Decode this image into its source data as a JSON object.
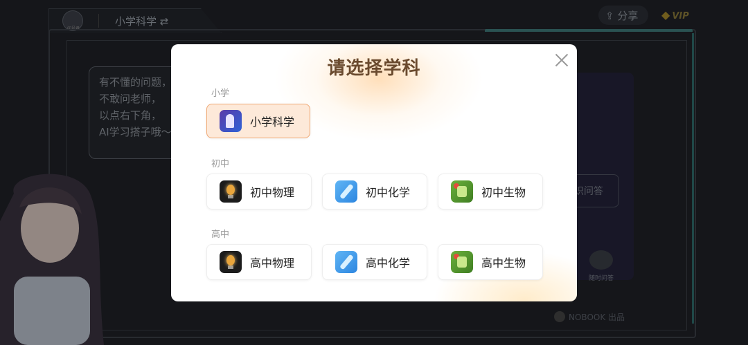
{
  "header": {
    "current_subject": "小学科学 ⇄",
    "share_label": "⇪ 分享",
    "vip_label": "VIP",
    "logo_caption": "问号君"
  },
  "speech_bubble": {
    "lines": [
      "有不懂的问题，",
      "不敢问老师，",
      "以点右下角，",
      "AI学习搭子哦～"
    ]
  },
  "right_panel": {
    "qa_button": "识问答",
    "bot_caption": "随时问答",
    "publisher": "NOBOOK 出品"
  },
  "modal": {
    "title": "请选择学科",
    "sections": [
      {
        "label": "小学",
        "items": [
          {
            "label": "小学科学",
            "icon": "science-icon",
            "selected": true
          }
        ]
      },
      {
        "label": "初中",
        "items": [
          {
            "label": "初中物理",
            "icon": "lightbulb-icon"
          },
          {
            "label": "初中化学",
            "icon": "dropper-icon"
          },
          {
            "label": "初中生物",
            "icon": "plant-icon"
          }
        ]
      },
      {
        "label": "高中",
        "items": [
          {
            "label": "高中物理",
            "icon": "lightbulb-icon"
          },
          {
            "label": "高中化学",
            "icon": "dropper-icon"
          },
          {
            "label": "高中生物",
            "icon": "plant-icon"
          }
        ]
      }
    ]
  },
  "colors": {
    "selected_bg": "#fde9d9",
    "selected_border": "#f0a873",
    "title": "#6a4a2e"
  }
}
